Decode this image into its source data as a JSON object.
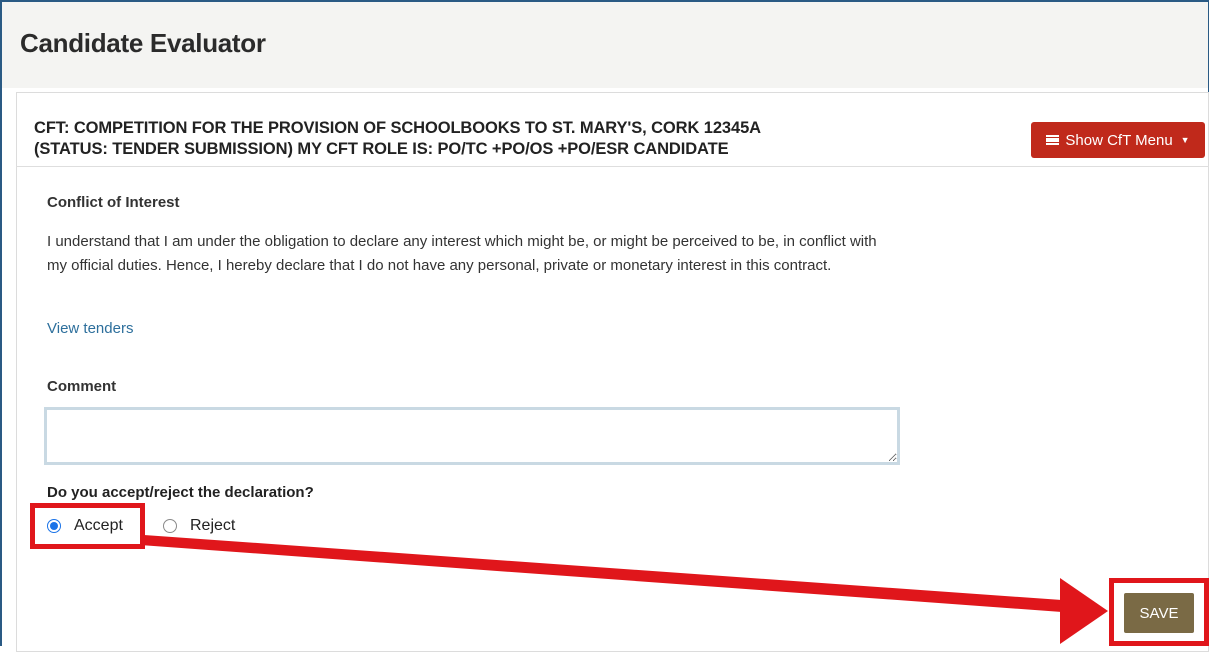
{
  "app": {
    "title": "Candidate Evaluator"
  },
  "cft": {
    "title_line1": "CFT: COMPETITION FOR THE PROVISION OF SCHOOLBOOKS TO ST. MARY'S, CORK 12345A",
    "title_line2": "(STATUS: TENDER SUBMISSION) MY CFT ROLE IS: PO/TC +PO/OS +PO/ESR CANDIDATE",
    "menu_button_label": "Show CfT Menu"
  },
  "declaration": {
    "heading": "Conflict of Interest",
    "text": "I understand that I am under the obligation to declare any interest which might be, or might be perceived to be, in conflict with my official duties. Hence, I hereby declare that I do not have any personal, private or monetary interest in this contract.",
    "link_label": "View tenders"
  },
  "comment": {
    "label": "Comment",
    "value": ""
  },
  "decision": {
    "question": "Do you accept/reject the declaration?",
    "options": [
      {
        "label": "Accept",
        "selected": true
      },
      {
        "label": "Reject",
        "selected": false
      }
    ]
  },
  "actions": {
    "save_label": "SAVE"
  },
  "colors": {
    "menu_button": "#c0291b",
    "save_button": "#7a6a45",
    "annotation": "#e0161b",
    "link": "#2d6f9c",
    "radio_selected": "#1a73e8"
  },
  "icons": {
    "menu": "list-icon",
    "dropdown": "caret-down-icon"
  }
}
